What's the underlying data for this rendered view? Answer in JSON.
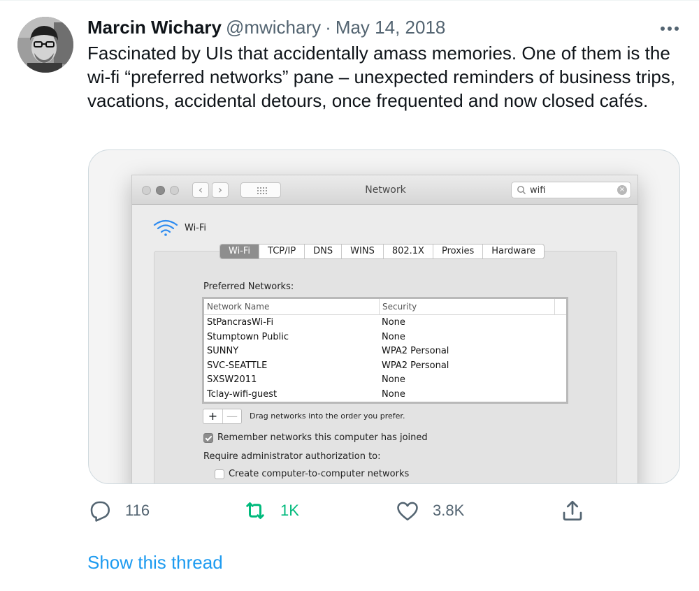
{
  "tweet": {
    "author_name": "Marcin Wichary",
    "author_handle": "@mwichary",
    "separator": "·",
    "date": "May 14, 2018",
    "text": "Fascinated by UIs that accidentally amass memories. One of them is the wi-fi “preferred networks” pane – unexpected reminders of business trips, vacations, accidental detours, once frequented and now closed cafés."
  },
  "icons": {
    "avatar": "avatar-photo",
    "more": "more-horizontal-icon",
    "reply": "reply-icon",
    "retweet": "retweet-icon",
    "like": "heart-icon",
    "share": "share-icon",
    "wifi": "wifi-icon",
    "search": "search-icon"
  },
  "screenshot": {
    "window_title": "Network",
    "search_value": "wifi",
    "pane_title": "Wi-Fi",
    "tabs": [
      {
        "label": "Wi-Fi",
        "active": true
      },
      {
        "label": "TCP/IP",
        "active": false
      },
      {
        "label": "DNS",
        "active": false
      },
      {
        "label": "WINS",
        "active": false
      },
      {
        "label": "802.1X",
        "active": false
      },
      {
        "label": "Proxies",
        "active": false
      },
      {
        "label": "Hardware",
        "active": false
      }
    ],
    "preferred_label": "Preferred Networks:",
    "columns": {
      "name": "Network Name",
      "security": "Security"
    },
    "networks": [
      {
        "name": "StPancrasWi-Fi",
        "security": "None"
      },
      {
        "name": "Stumptown Public",
        "security": "None"
      },
      {
        "name": "SUNNY",
        "security": "WPA2 Personal"
      },
      {
        "name": "SVC-SEATTLE",
        "security": "WPA2 Personal"
      },
      {
        "name": "SXSW2011",
        "security": "None"
      },
      {
        "name": "Tclay-wifi-guest",
        "security": "None"
      }
    ],
    "plus_label": "+",
    "minus_label": "—",
    "drag_hint": "Drag networks into the order you prefer.",
    "remember_label": "Remember networks this computer has joined",
    "remember_checked": true,
    "require_label": "Require administrator authorization to:",
    "create_label": "Create computer-to-computer networks",
    "create_checked": false
  },
  "actions": {
    "replies": "116",
    "retweets": "1K",
    "likes": "3.8K"
  },
  "show_thread": "Show this thread",
  "colors": {
    "link": "#1d9bf0",
    "retweet": "#00ba7c",
    "muted": "#536471",
    "text": "#0f1419"
  }
}
